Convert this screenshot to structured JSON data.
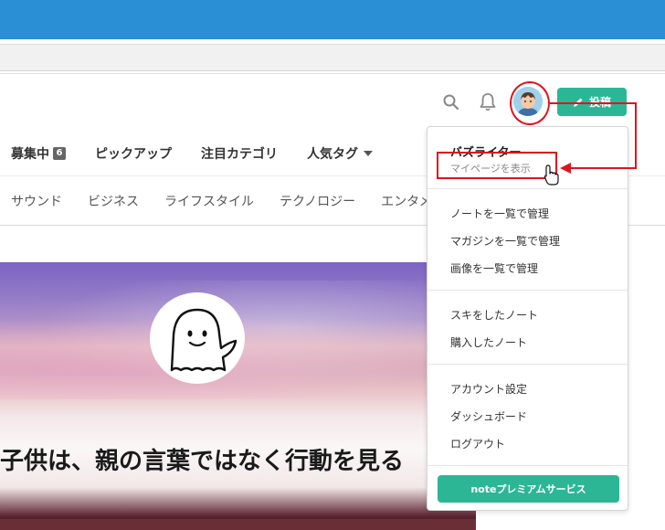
{
  "header": {
    "post_label": "投稿"
  },
  "nav_primary": [
    {
      "label": "募集中",
      "badge": "6"
    },
    {
      "label": "ピックアップ"
    },
    {
      "label": "注目カテゴリ"
    },
    {
      "label": "人気タグ"
    }
  ],
  "nav_secondary": [
    "サウンド",
    "ビジネス",
    "ライフスタイル",
    "テクノロジー",
    "エンタメ"
  ],
  "hero": {
    "title": "子供は、親の言葉ではなく行動を見る"
  },
  "menu": {
    "username": "バズライター",
    "mypage": "マイページを表示",
    "group1": [
      "ノートを一覧で管理",
      "マガジンを一覧で管理",
      "画像を一覧で管理"
    ],
    "group2": [
      "スキをしたノート",
      "購入したノート"
    ],
    "group3": [
      "アカウント設定",
      "ダッシュボード",
      "ログアウト"
    ],
    "premium_label": "noteプレミアムサービス"
  },
  "colors": {
    "brand": "#2cb696",
    "annotation": "#e0141e",
    "chrome_blue": "#2b8fd6"
  }
}
